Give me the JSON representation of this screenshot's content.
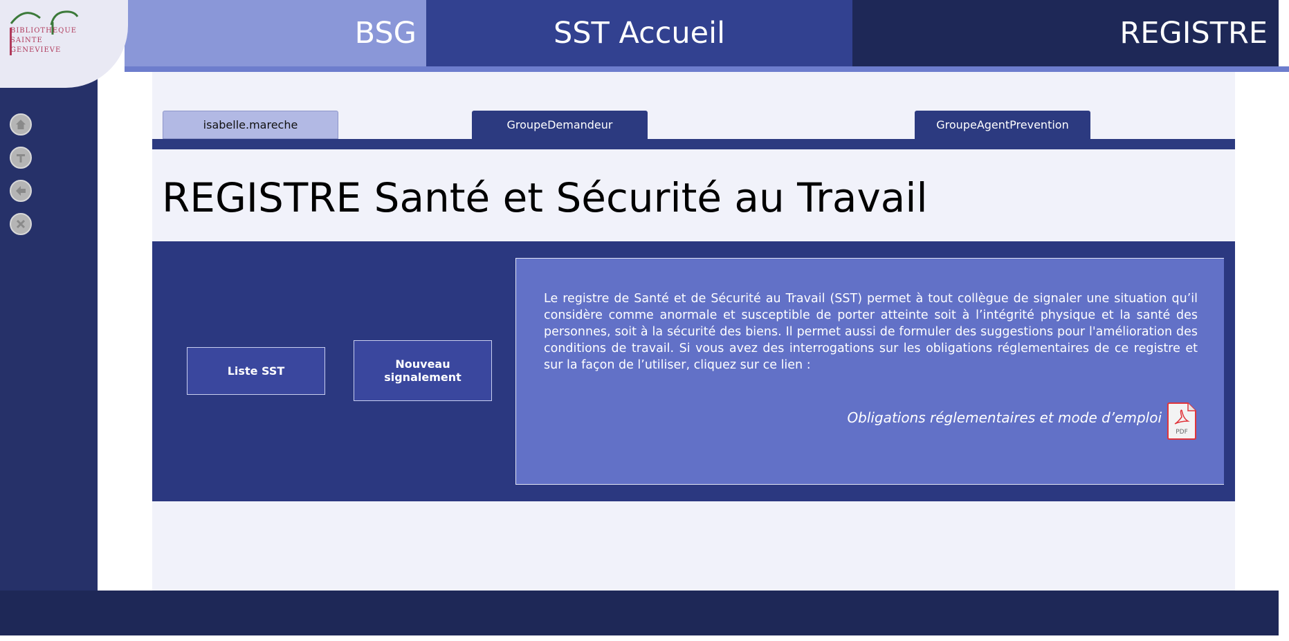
{
  "header": {
    "logo_lines": [
      "BIBLIOTHEQUE",
      "SAINTE",
      "GENEVIEVE"
    ],
    "bsg": "BSG",
    "sst_home": "SST Accueil",
    "registre": "REGISTRE"
  },
  "nav": {
    "icons": [
      "home-icon",
      "up-arrow-icon",
      "back-arrow-icon",
      "close-icon"
    ]
  },
  "user_tabs": {
    "user": "isabelle.mareche",
    "groupe_demandeur": "GroupeDemandeur",
    "groupe_agent": "GroupeAgentPrevention"
  },
  "page_title": "REGISTRE Santé et Sécurité au Travail",
  "actions": {
    "liste": "Liste SST",
    "nouveau_line1": "Nouveau",
    "nouveau_line2": "signalement"
  },
  "info": {
    "text": "Le registre de Santé et de Sécurité au Travail (SST) permet à tout collègue de signaler une situation qu’il considère comme anormale et susceptible de porter atteinte soit à l’intégrité physique et la santé des personnes, soit à la sécurité des biens. Il permet aussi de formuler des suggestions pour l'amélioration des conditions de travail. Si vous avez des interrogations sur les obligations réglementaires de ce registre et sur la façon de l’utiliser, cliquez sur ce lien :",
    "link": "Obligations réglementaires et mode d’emploi",
    "pdf_label": "PDF"
  },
  "colors": {
    "header_light": "#8a97d8",
    "header_mid": "#324190",
    "header_dark": "#1e2857",
    "panel": "#2b3880",
    "info_box": "#6271c7",
    "logo_red": "#b03a5b",
    "logo_green": "#3c7a3a"
  }
}
